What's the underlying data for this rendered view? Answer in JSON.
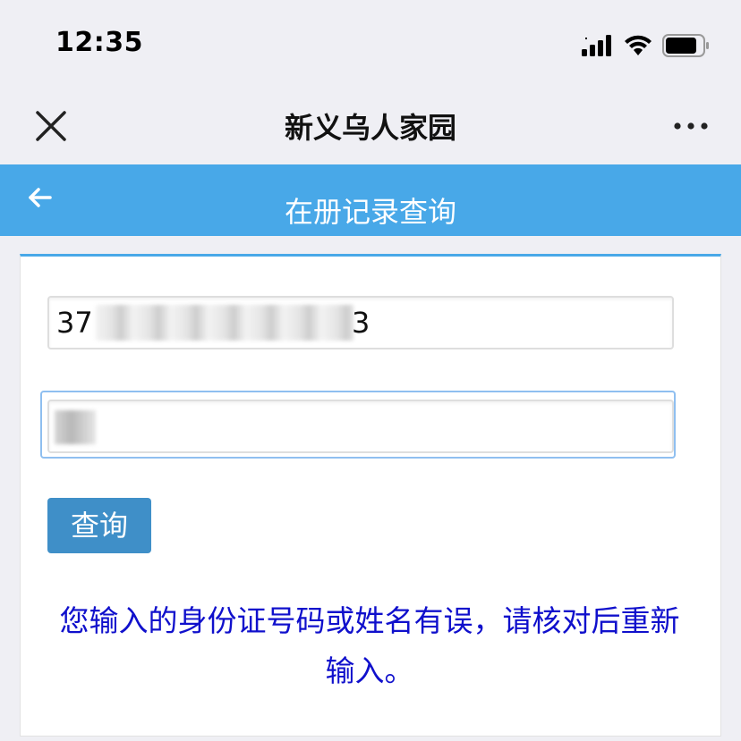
{
  "status_bar": {
    "time": "12:35"
  },
  "wechat_nav": {
    "title": "新义乌人家园"
  },
  "header": {
    "title": "在册记录查询"
  },
  "form": {
    "id_number": {
      "prefix": "37",
      "suffix": "3"
    },
    "submit_label": "查询"
  },
  "message": {
    "text": "您输入的身份证号码或姓名有误，请核对后重新输入。"
  },
  "colors": {
    "header_bg": "#48a8e8",
    "button_bg": "#3f8fc8",
    "message_text": "#1010cc"
  },
  "icons": {
    "close": "close-icon",
    "more": "more-icon",
    "back": "back-arrow-icon",
    "signal": "signal-icon",
    "wifi": "wifi-icon",
    "battery": "battery-icon"
  }
}
